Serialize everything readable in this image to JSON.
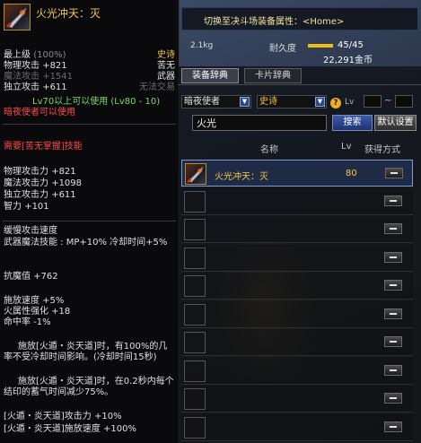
{
  "item": {
    "name": "火光冲天：灭",
    "rarity": "史诗",
    "grade": "最上级",
    "grade_pct": "(100%)",
    "stats_top": [
      {
        "label": "物理攻击",
        "value": "+821",
        "cls": "c-white"
      },
      {
        "label": "魔法攻击",
        "value": "+1541",
        "cls": "c-dim"
      },
      {
        "label": "独立攻击",
        "value": "+611",
        "cls": "c-white"
      }
    ],
    "right_tags": [
      "苦无",
      "武器",
      "无法交易"
    ],
    "level_req": "Lv70以上可以使用 (Lv80 - 10)",
    "class_req": "暗夜使者可以使用",
    "skill_req": "需要[苦无掌握]技能",
    "attack_stats": [
      {
        "label": "物理攻击力",
        "value": "+821"
      },
      {
        "label": "魔法攻击力",
        "value": "+1098"
      },
      {
        "label": "独立攻击力",
        "value": "+611"
      },
      {
        "label": "智力",
        "value": "+101"
      }
    ],
    "speed": "缓慢攻击速度",
    "weapon_skill": "武器魔法技能 : MP+10% 冷却时间+5%",
    "demonic": "抗魔值 +762",
    "extra_stats": [
      "施放速度 +5%",
      "火属性强化 +18",
      "命中率 -1%"
    ],
    "desc1": "施放[火遁・炎天道]时，有100%的几率不受冷却时间影响。(冷却时间15秒)",
    "desc2": "施放[火遁・炎天道]时，在0.2秒内每个结印的蓄气时间减少75%。",
    "bonus": [
      "[火遁・炎天道]攻击力 +10%",
      "[火遁・炎天道]施放速度 +100%"
    ]
  },
  "topbar": {
    "switch_text": "切换至决斗场装备属性：<Home>"
  },
  "inventory": {
    "weight": "2.1kg",
    "durability_label": "耐久度",
    "durability_value": "45/45",
    "durability_fraction": 1.0,
    "gold": "22,291金币"
  },
  "window": {
    "tabs": [
      {
        "label": "装备辞典",
        "active": true
      },
      {
        "label": "卡片辞典",
        "active": false
      }
    ],
    "class_select": "暗夜使者",
    "rarity_select": "史诗",
    "lv_label": "Lv",
    "lv_tilde": "~",
    "help": "?",
    "search_value": "火光",
    "search_button": "搜索",
    "default_button": "默认设置",
    "columns": {
      "name": "名称",
      "lv": "Lv",
      "method": "获得方式"
    },
    "rows": [
      {
        "name": "火光冲天：灭",
        "lv": "80",
        "selected": true
      },
      {
        "name": "",
        "lv": "",
        "selected": false
      },
      {
        "name": "",
        "lv": "",
        "selected": false
      },
      {
        "name": "",
        "lv": "",
        "selected": false
      },
      {
        "name": "",
        "lv": "",
        "selected": false
      },
      {
        "name": "",
        "lv": "",
        "selected": false
      },
      {
        "name": "",
        "lv": "",
        "selected": false
      },
      {
        "name": "",
        "lv": "",
        "selected": false
      },
      {
        "name": "",
        "lv": "",
        "selected": false
      },
      {
        "name": "",
        "lv": "",
        "selected": false
      }
    ]
  }
}
